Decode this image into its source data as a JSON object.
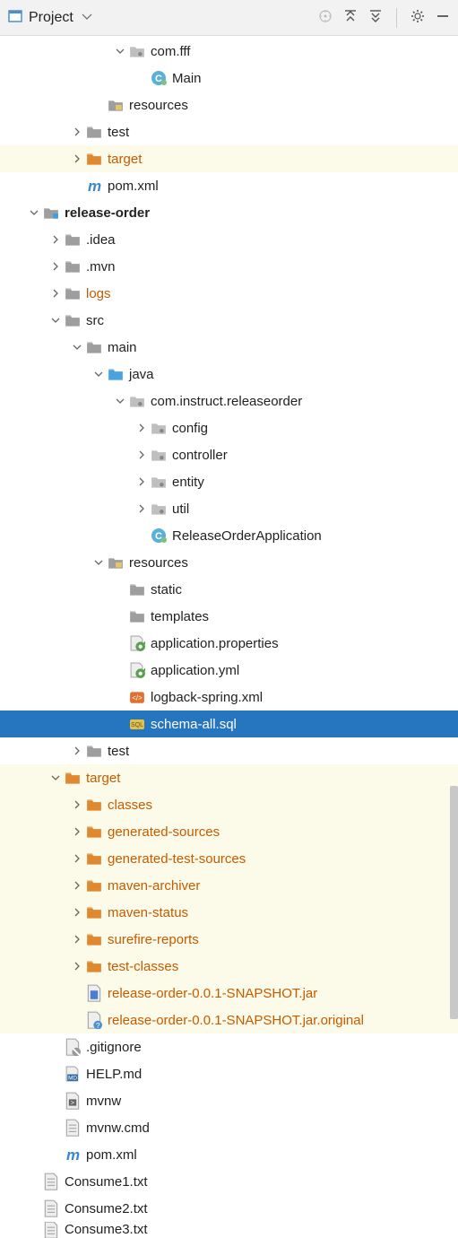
{
  "header": {
    "title": "Project"
  },
  "tree": [
    {
      "indent": 5,
      "arrow": "down",
      "icon": "pkg",
      "label": "com.fff",
      "style": ""
    },
    {
      "indent": 6,
      "arrow": "none",
      "icon": "class",
      "label": "Main",
      "style": ""
    },
    {
      "indent": 4,
      "arrow": "none",
      "icon": "folder-res",
      "label": "resources",
      "style": ""
    },
    {
      "indent": 3,
      "arrow": "right",
      "icon": "folder-gray",
      "label": "test",
      "style": ""
    },
    {
      "indent": 3,
      "arrow": "right",
      "icon": "folder-orange",
      "label": "target",
      "style": "orange yellow-bg"
    },
    {
      "indent": 3,
      "arrow": "none",
      "icon": "m",
      "label": "pom.xml",
      "style": ""
    },
    {
      "indent": 1,
      "arrow": "down",
      "icon": "module",
      "label": "release-order",
      "style": "bold"
    },
    {
      "indent": 2,
      "arrow": "right",
      "icon": "folder-gray",
      "label": ".idea",
      "style": ""
    },
    {
      "indent": 2,
      "arrow": "right",
      "icon": "folder-gray",
      "label": ".mvn",
      "style": ""
    },
    {
      "indent": 2,
      "arrow": "right",
      "icon": "folder-gray",
      "label": "logs",
      "style": "orange"
    },
    {
      "indent": 2,
      "arrow": "down",
      "icon": "folder-gray",
      "label": "src",
      "style": ""
    },
    {
      "indent": 3,
      "arrow": "down",
      "icon": "folder-gray",
      "label": "main",
      "style": ""
    },
    {
      "indent": 4,
      "arrow": "down",
      "icon": "folder-blue",
      "label": "java",
      "style": ""
    },
    {
      "indent": 5,
      "arrow": "down",
      "icon": "pkg",
      "label": "com.instruct.releaseorder",
      "style": ""
    },
    {
      "indent": 6,
      "arrow": "right",
      "icon": "pkg",
      "label": "config",
      "style": ""
    },
    {
      "indent": 6,
      "arrow": "right",
      "icon": "pkg",
      "label": "controller",
      "style": ""
    },
    {
      "indent": 6,
      "arrow": "right",
      "icon": "pkg",
      "label": "entity",
      "style": ""
    },
    {
      "indent": 6,
      "arrow": "right",
      "icon": "pkg",
      "label": "util",
      "style": ""
    },
    {
      "indent": 6,
      "arrow": "none",
      "icon": "class",
      "label": "ReleaseOrderApplication",
      "style": ""
    },
    {
      "indent": 4,
      "arrow": "down",
      "icon": "folder-res",
      "label": "resources",
      "style": ""
    },
    {
      "indent": 5,
      "arrow": "none",
      "icon": "folder-gray",
      "label": "static",
      "style": ""
    },
    {
      "indent": 5,
      "arrow": "none",
      "icon": "folder-gray",
      "label": "templates",
      "style": ""
    },
    {
      "indent": 5,
      "arrow": "none",
      "icon": "prop",
      "label": "application.properties",
      "style": ""
    },
    {
      "indent": 5,
      "arrow": "none",
      "icon": "prop",
      "label": "application.yml",
      "style": ""
    },
    {
      "indent": 5,
      "arrow": "none",
      "icon": "xml",
      "label": "logback-spring.xml",
      "style": ""
    },
    {
      "indent": 5,
      "arrow": "none",
      "icon": "sql",
      "label": "schema-all.sql",
      "style": "selected"
    },
    {
      "indent": 3,
      "arrow": "right",
      "icon": "folder-gray",
      "label": "test",
      "style": ""
    },
    {
      "indent": 2,
      "arrow": "down",
      "icon": "folder-orange",
      "label": "target",
      "style": "orange yellow-bg"
    },
    {
      "indent": 3,
      "arrow": "right",
      "icon": "folder-orange",
      "label": "classes",
      "style": "orange yellow-bg"
    },
    {
      "indent": 3,
      "arrow": "right",
      "icon": "folder-orange",
      "label": "generated-sources",
      "style": "orange yellow-bg"
    },
    {
      "indent": 3,
      "arrow": "right",
      "icon": "folder-orange",
      "label": "generated-test-sources",
      "style": "orange yellow-bg"
    },
    {
      "indent": 3,
      "arrow": "right",
      "icon": "folder-orange",
      "label": "maven-archiver",
      "style": "orange yellow-bg"
    },
    {
      "indent": 3,
      "arrow": "right",
      "icon": "folder-orange",
      "label": "maven-status",
      "style": "orange yellow-bg"
    },
    {
      "indent": 3,
      "arrow": "right",
      "icon": "folder-orange",
      "label": "surefire-reports",
      "style": "orange yellow-bg"
    },
    {
      "indent": 3,
      "arrow": "right",
      "icon": "folder-orange",
      "label": "test-classes",
      "style": "orange yellow-bg"
    },
    {
      "indent": 3,
      "arrow": "none",
      "icon": "jar",
      "label": "release-order-0.0.1-SNAPSHOT.jar",
      "style": "orange yellow-bg"
    },
    {
      "indent": 3,
      "arrow": "none",
      "icon": "file-q",
      "label": "release-order-0.0.1-SNAPSHOT.jar.original",
      "style": "orange yellow-bg"
    },
    {
      "indent": 2,
      "arrow": "none",
      "icon": "file-excl",
      "label": ".gitignore",
      "style": ""
    },
    {
      "indent": 2,
      "arrow": "none",
      "icon": "md",
      "label": "HELP.md",
      "style": ""
    },
    {
      "indent": 2,
      "arrow": "none",
      "icon": "bat",
      "label": "mvnw",
      "style": ""
    },
    {
      "indent": 2,
      "arrow": "none",
      "icon": "file",
      "label": "mvnw.cmd",
      "style": ""
    },
    {
      "indent": 2,
      "arrow": "none",
      "icon": "m",
      "label": "pom.xml",
      "style": ""
    },
    {
      "indent": 1,
      "arrow": "none",
      "icon": "file",
      "label": "Consume1.txt",
      "style": ""
    },
    {
      "indent": 1,
      "arrow": "none",
      "icon": "file",
      "label": "Consume2.txt",
      "style": ""
    },
    {
      "indent": 1,
      "arrow": "none",
      "icon": "file",
      "label": "Consume3.txt",
      "style": "cut"
    }
  ]
}
